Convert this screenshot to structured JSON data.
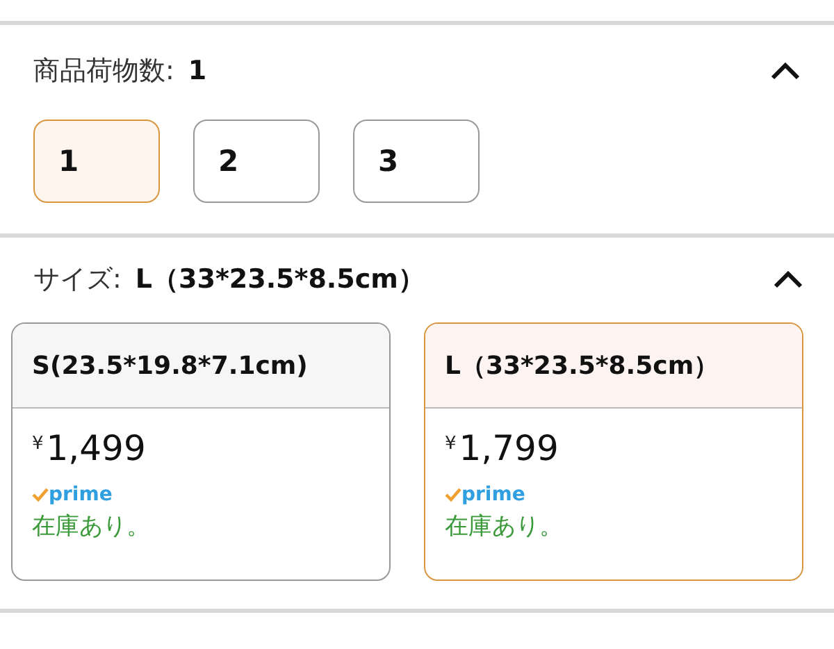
{
  "sections": [
    {
      "label": "商品荷物数:",
      "value": "1",
      "expanded": true,
      "kind": "chips",
      "options": [
        {
          "label": "1",
          "selected": true
        },
        {
          "label": "2",
          "selected": false
        },
        {
          "label": "3",
          "selected": false
        }
      ]
    },
    {
      "label": "サイズ:",
      "value": "L（33*23.5*8.5cm）",
      "expanded": true,
      "kind": "cards",
      "options": [
        {
          "label": "S(23.5*19.8*7.1cm)",
          "currency": "¥",
          "price": "1,499",
          "badge": "prime",
          "stock": "在庫あり。",
          "selected": false
        },
        {
          "label": "L（33*23.5*8.5cm）",
          "currency": "¥",
          "price": "1,799",
          "badge": "prime",
          "stock": "在庫あり。",
          "selected": true
        }
      ]
    }
  ]
}
